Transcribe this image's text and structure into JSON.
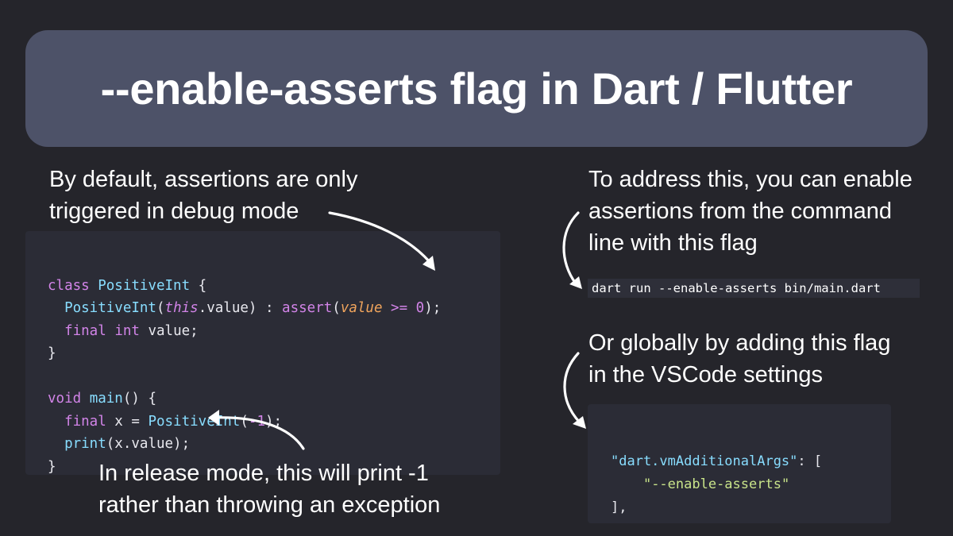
{
  "title": "--enable-asserts flag in Dart / Flutter",
  "captions": {
    "debug_default": [
      "By default, assertions are only",
      "triggered in debug mode"
    ],
    "release_mode": [
      "In release mode, this will print -1",
      "rather than throwing an exception"
    ],
    "command_line": [
      "To address this, you can enable",
      "assertions from the command",
      "line with this flag"
    ],
    "vscode": [
      "Or globally by adding this flag",
      "in the VSCode settings"
    ]
  },
  "dart_code": {
    "l1": {
      "kw_class": "class",
      "type": "PositiveInt",
      "brace": " {"
    },
    "l2": {
      "ctor": "PositiveInt",
      "p_open": "(",
      "this_kw": "this",
      "rest": ".value) : ",
      "assert_kw": "assert",
      "a_open": "(",
      "value_ref": "value",
      "op": " >= ",
      "zero": "0",
      "end": ");"
    },
    "l3": {
      "final_kw": "final",
      "int_type": "int",
      "rest": "value;"
    },
    "l4": "}",
    "l5": {
      "void_kw": "void",
      "main_fn": "main",
      "rest": "() {"
    },
    "l6": {
      "final_kw": "final",
      "mid": " x = ",
      "ctor": "PositiveInt",
      "open": "(",
      "neg": "-1",
      "close": ");"
    },
    "l7": {
      "print_fn": "print",
      "rest": "(x.value);"
    },
    "l8": "}"
  },
  "command": "dart run --enable-asserts bin/main.dart",
  "settings_json": {
    "key": "\"dart.vmAdditionalArgs\"",
    "key_tail": ": [",
    "value": "\"--enable-asserts\"",
    "closing": "],"
  },
  "colors": {
    "background": "#25252b",
    "banner": "#4d5268",
    "code_panel": "#2b2c36",
    "keyword": "#d284e8",
    "type": "#88ddff",
    "string": "#c9e48a",
    "assert_param": "#f0a45c"
  }
}
